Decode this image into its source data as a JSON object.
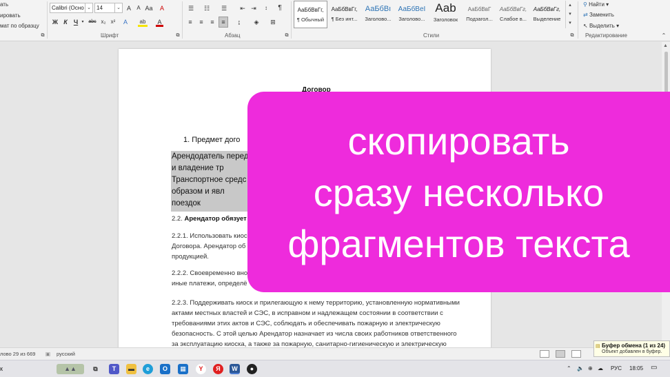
{
  "ribbon": {
    "clipboard": {
      "items": [
        "ать",
        "ировать",
        "мат по образцу"
      ]
    },
    "font": {
      "name": "Calibri (Осно",
      "size": "14",
      "grow": "A",
      "shrink": "A",
      "case": "Аа",
      "clear": "A",
      "bold": "Ж",
      "italic": "К",
      "underline": "Ч",
      "strike": "abc",
      "subscript": "x₂",
      "superscript": "x²",
      "effects": "A",
      "highlight": "ab",
      "color": "A",
      "label": "Шрифт"
    },
    "paragraph": {
      "label": "Абзац",
      "pilcrow": "¶"
    },
    "styles": {
      "label": "Стили",
      "items": [
        {
          "sample": "АаБбВвГг,",
          "name": "¶ Обычный"
        },
        {
          "sample": "АаБбВвГг,",
          "name": "¶ Без инт..."
        },
        {
          "sample": "АаБбВı",
          "name": "Заголово..."
        },
        {
          "sample": "АаБбВеI",
          "name": "Заголово..."
        },
        {
          "sample": "Ааb",
          "name": "Заголовок"
        },
        {
          "sample": "АаБбВвГ",
          "name": "Подзагол..."
        },
        {
          "sample": "АаБбВвГг,",
          "name": "Слабое в..."
        },
        {
          "sample": "АаБбВвГг,",
          "name": "Выделение"
        }
      ]
    },
    "editing": {
      "label": "Редактирование",
      "find": "Найти",
      "replace": "Заменить",
      "select": "Выделить"
    }
  },
  "document": {
    "title": "Договор",
    "list_item": "1.  Предмет дого",
    "selected_lines": [
      "Арендодатель перед",
      "и владение          тр",
      "Транспортное средс",
      "образом          и явл",
      "поездок"
    ],
    "section_heading_num": "2.2.",
    "section_heading": "Арендатор обязует",
    "para_221": [
      "2.2.1. Использовать киос",
      "Договора. Арендатор об",
      "продукцией."
    ],
    "para_222": [
      "2.2.2. Своевременно вно",
      "иные платежи, определё"
    ],
    "para_223": [
      "2.2.3. Поддерживать киоск и прилегающую к нему территорию, установленную нормативными",
      "актами местных властей и СЭС, в исправном и надлежащем состоянии в соответствии с",
      "требованиями этих актов и СЭС, соблюдать и обеспечивать пожарную и электрическую",
      "безопасность. С этой целью Арендатор назначает из числа своих работников ответственного",
      "за эксплуатацию киоска, а также за пожарную, санитарно-гигиеническую и электрическую"
    ]
  },
  "overlay": {
    "lines": [
      "скопировать",
      "сразу несколько",
      "фрагментов текста"
    ],
    "color": "#ee2bdc"
  },
  "status": {
    "words": "лово 29 из 669",
    "language": "русский"
  },
  "clipboard_toast": {
    "title": "Буфер обмена (1 из 24)",
    "message": "Объект добавлен в буфер."
  },
  "taskbar": {
    "left_char": "к",
    "language": "РУС",
    "time": "18:05"
  }
}
